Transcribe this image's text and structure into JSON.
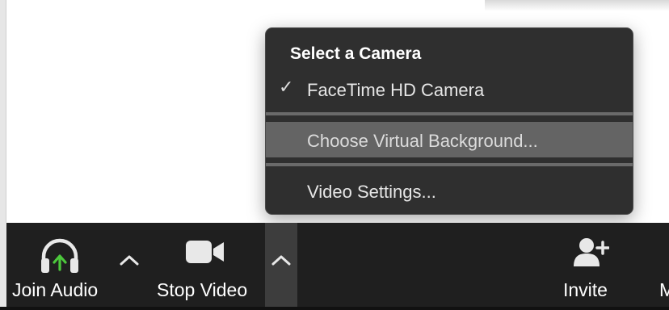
{
  "camera_menu": {
    "heading": "Select a Camera",
    "items": [
      {
        "label": "FaceTime HD Camera",
        "checked": true
      },
      {
        "label": "Choose Virtual Background...",
        "highlighted": true
      },
      {
        "label": "Video Settings..."
      }
    ]
  },
  "toolbar": {
    "join_audio": {
      "label": "Join Audio",
      "icon": "headphones-icon",
      "arrow_color": "#4cc83c"
    },
    "stop_video": {
      "label": "Stop Video",
      "icon": "video-camera-icon"
    },
    "invite": {
      "label": "Invite",
      "icon": "add-user-icon"
    },
    "more_partial": "M"
  },
  "colors": {
    "toolbar_bg": "#1f1f1f",
    "menu_bg": "#2f2f2f",
    "menu_highlight": "#646464",
    "audio_arrow": "#4cc83c"
  }
}
